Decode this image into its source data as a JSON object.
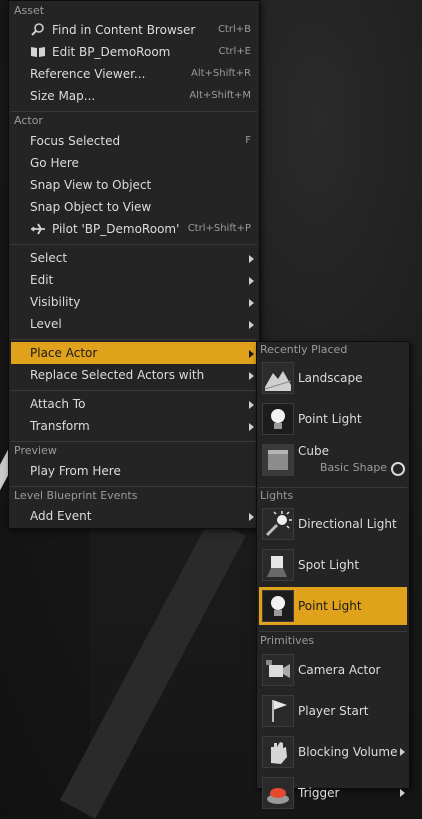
{
  "menu": {
    "sections": [
      {
        "header": "Asset",
        "items": [
          {
            "label": "Find in Content Browser",
            "shortcut": "Ctrl+B",
            "icon": "magnifier-icon"
          },
          {
            "label": "Edit BP_DemoRoom",
            "shortcut": "Ctrl+E",
            "icon": "book-icon"
          },
          {
            "label": "Reference Viewer...",
            "shortcut": "Alt+Shift+R"
          },
          {
            "label": "Size Map...",
            "shortcut": "Alt+Shift+M"
          }
        ]
      },
      {
        "header": "Actor",
        "items": [
          {
            "label": "Focus Selected",
            "shortcut": "F"
          },
          {
            "label": "Go Here"
          },
          {
            "label": "Snap View to Object"
          },
          {
            "label": "Snap Object to View"
          },
          {
            "label": "Pilot 'BP_DemoRoom'",
            "shortcut": "Ctrl+Shift+P",
            "icon": "airplane-icon"
          }
        ]
      },
      {
        "items": [
          {
            "label": "Select"
          },
          {
            "label": "Edit"
          },
          {
            "label": "Visibility"
          },
          {
            "label": "Level"
          }
        ]
      },
      {
        "items": [
          {
            "label": "Place Actor",
            "highlighted": true
          },
          {
            "label": "Replace Selected Actors with"
          }
        ]
      },
      {
        "items": [
          {
            "label": "Attach To"
          },
          {
            "label": "Transform"
          }
        ]
      },
      {
        "header": "Preview",
        "items": [
          {
            "label": "Play From Here"
          }
        ]
      },
      {
        "header": "Level Blueprint Events",
        "items": [
          {
            "label": "Add Event"
          }
        ]
      }
    ]
  },
  "submenu": {
    "sections": [
      {
        "header": "Recently Placed",
        "items": [
          {
            "label": "Landscape",
            "icon": "landscape-icon"
          },
          {
            "label": "Point Light",
            "icon": "point-light-icon"
          },
          {
            "label": "Cube",
            "sublabel": "Basic Shape",
            "icon": "cube-icon"
          }
        ]
      },
      {
        "header": "Lights",
        "items": [
          {
            "label": "Directional Light",
            "icon": "directional-light-icon"
          },
          {
            "label": "Spot Light",
            "icon": "spot-light-icon"
          },
          {
            "label": "Point Light",
            "icon": "point-light-icon",
            "highlighted": true
          }
        ]
      },
      {
        "header": "Primitives",
        "items": [
          {
            "label": "Camera Actor",
            "icon": "camera-icon"
          },
          {
            "label": "Player Start",
            "icon": "player-start-icon"
          },
          {
            "label": "Blocking Volume",
            "icon": "blocking-volume-icon",
            "submenu": true
          },
          {
            "label": "Trigger",
            "icon": "trigger-icon",
            "submenu": true
          }
        ]
      }
    ]
  },
  "colors": {
    "highlight": "#e0a21a",
    "menu_bg": "#242424"
  }
}
